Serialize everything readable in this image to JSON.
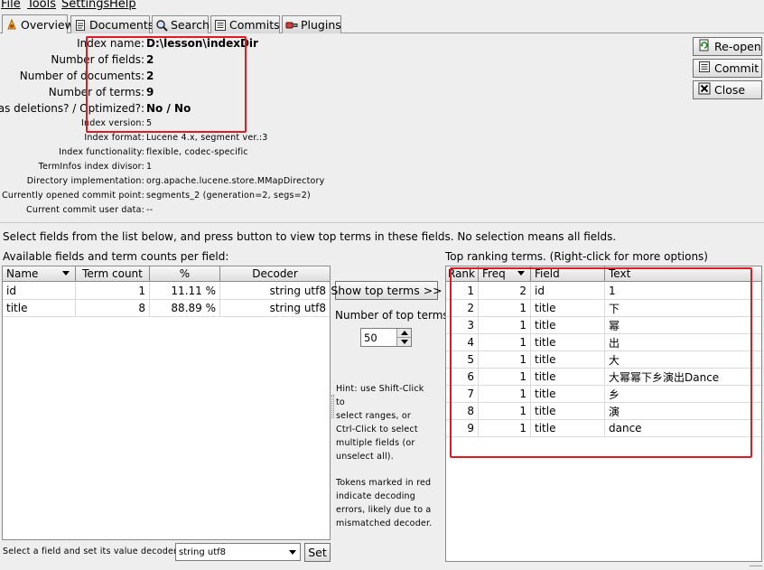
{
  "menu": [
    "File",
    "Tools",
    "Settings",
    "Help"
  ],
  "tabs": [
    {
      "label": "Overview",
      "icon": "lucene-icon"
    },
    {
      "label": "Documents",
      "icon": "document-icon"
    },
    {
      "label": "Search",
      "icon": "magnifier-icon"
    },
    {
      "label": "Commits",
      "icon": "commit-list-icon"
    },
    {
      "label": "Plugins",
      "icon": "plugin-icon"
    }
  ],
  "overview": {
    "index_name_label": "Index name:",
    "index_name": "D:\\lesson\\indexDir",
    "num_fields_label": "Number of fields:",
    "num_fields": "2",
    "num_docs_label": "Number of documents:",
    "num_docs": "2",
    "num_terms_label": "Number of terms:",
    "num_terms": "9",
    "deletions_label": "Has deletions? / Optimized?:",
    "deletions": "No / No",
    "index_version_label": "Index version:",
    "index_version": "5",
    "index_format_label": "Index format:",
    "index_format": "Lucene 4.x, segment ver.:3",
    "index_functionality_label": "Index functionality:",
    "index_functionality": "flexible, codec-specific",
    "terminfos_label": "TermInfos index divisor:",
    "terminfos": "1",
    "directory_impl_label": "Directory implementation:",
    "directory_impl": "org.apache.lucene.store.MMapDirectory",
    "commit_point_label": "Currently opened commit point:",
    "commit_point": "segments_2 (generation=2, segs=2)",
    "commit_userdata_label": "Current commit user data:",
    "commit_userdata": "--"
  },
  "right_buttons": {
    "reopen": "Re-open",
    "commit": "Commit",
    "close": "Close"
  },
  "instruction": "Select fields from the list below, and press button to view top terms in these fields. No selection means all fields.",
  "fields_panel": {
    "title": "Available fields and term counts per field:",
    "columns": [
      "Name",
      "Term count",
      "%",
      "Decoder"
    ],
    "rows": [
      [
        "id",
        "1",
        "11.11 %",
        "string utf8"
      ],
      [
        "title",
        "8",
        "88.89 %",
        "string utf8"
      ]
    ]
  },
  "middle": {
    "show_top_terms": "Show top terms >>",
    "num_top_terms_label": "Number of top terms:",
    "num_top_terms": "50",
    "hint_lines": [
      "Hint: use Shift-Click to",
      "select ranges, or",
      "Ctrl-Click to select",
      "multiple fields (or",
      "unselect all)."
    ],
    "tokens_lines": [
      "Tokens marked in red",
      "indicate decoding",
      "errors, likely due to a",
      "mismatched decoder."
    ]
  },
  "top_terms_panel": {
    "title": "Top ranking terms. (Right-click for more options)",
    "columns": [
      "Rank",
      "Freq",
      "Field",
      "Text"
    ],
    "rows": [
      [
        "1",
        "2",
        "id",
        "1"
      ],
      [
        "2",
        "1",
        "title",
        "下"
      ],
      [
        "3",
        "1",
        "title",
        "幂"
      ],
      [
        "4",
        "1",
        "title",
        "出"
      ],
      [
        "5",
        "1",
        "title",
        "大"
      ],
      [
        "6",
        "1",
        "title",
        "大幂幂下乡演出Dance"
      ],
      [
        "7",
        "1",
        "title",
        "乡"
      ],
      [
        "8",
        "1",
        "title",
        "演"
      ],
      [
        "9",
        "1",
        "title",
        "dance"
      ]
    ]
  },
  "decoder_bar": {
    "label": "Select a field and set its value decoder:",
    "value": "string utf8",
    "set": "Set"
  },
  "colors": {
    "annotation": "#e01b24"
  }
}
